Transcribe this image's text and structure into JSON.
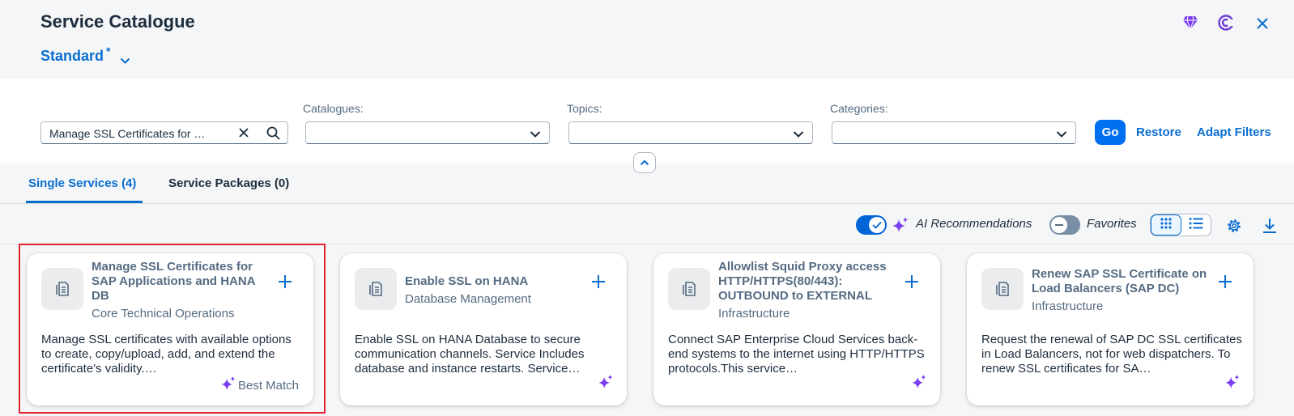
{
  "header": {
    "title": "Service Catalogue",
    "variant": "Standard",
    "variant_modified": "*",
    "icons": [
      "diamond-icon",
      "copilot-icon",
      "close-icon"
    ]
  },
  "filters": {
    "search_value": "Manage SSL Certificates for …",
    "catalogues_label": "Catalogues:",
    "catalogues_value": "",
    "topics_label": "Topics:",
    "topics_value": "",
    "categories_label": "Categories:",
    "categories_value": "",
    "go": "Go",
    "restore": "Restore",
    "adapt": "Adapt Filters"
  },
  "tabs": [
    {
      "label": "Single Services (4)",
      "active": true
    },
    {
      "label": "Service Packages (0)",
      "active": false
    }
  ],
  "toolbar": {
    "ai_label": "AI Recommendations",
    "ai_on": true,
    "fav_label": "Favorites",
    "fav_on": false
  },
  "cards": [
    {
      "title": "Manage SSL Certificates for SAP Applications and HANA DB",
      "subtitle": "Core Technical Operations",
      "description": "Manage SSL certificates with available options to create, copy/upload, add, and extend the certificate's validity.…",
      "badge": "Best Match"
    },
    {
      "title": "Enable SSL on HANA",
      "subtitle": "Database Management",
      "description": "Enable SSL on HANA Database to secure communication channels. Service Includes database and instance restarts. Service…",
      "badge": ""
    },
    {
      "title": "Allowlist Squid Proxy access HTTP/HTTPS(80/443): OUTBOUND to EXTERNAL",
      "subtitle": "Infrastructure",
      "description": "Connect SAP Enterprise Cloud Services back-end systems to the internet using HTTP/HTTPS protocols.This service…",
      "badge": ""
    },
    {
      "title": "Renew SAP SSL Certificate on Load Balancers (SAP DC)",
      "subtitle": "Infrastructure",
      "description": "Request the renewal of SAP DC SSL certificates in Load Balancers, not for web dispatchers. To renew SSL certificates for SA…",
      "badge": ""
    }
  ],
  "colors": {
    "accent": "#0a6ed1",
    "ai_purple": "#7b3ff2",
    "highlight": "#e3222c"
  }
}
